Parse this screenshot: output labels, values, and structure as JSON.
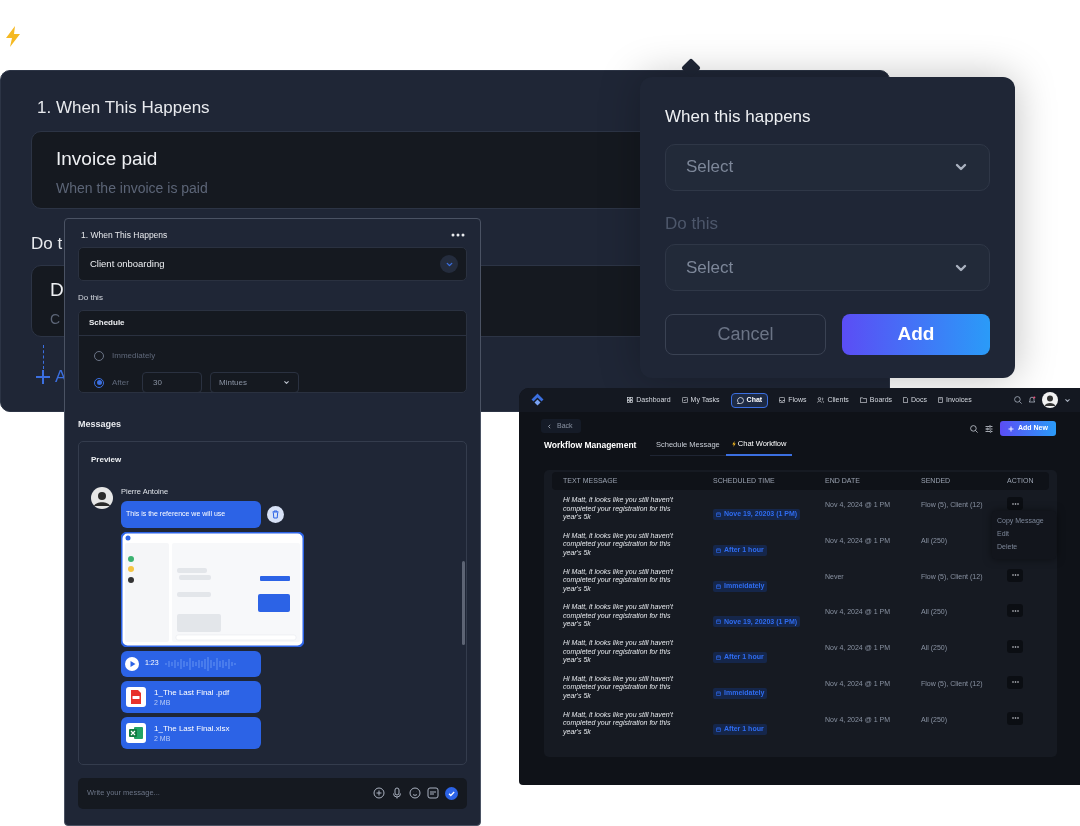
{
  "back_panel": {
    "title": "1. When This Happens",
    "trigger": {
      "title": "Invoice paid",
      "subtitle": "When the invoice is paid"
    },
    "action_label": "Do t",
    "action": {
      "title": "D",
      "subtitle": "C"
    },
    "add_link": "A"
  },
  "trigger_popover": {
    "heading": "When this happens",
    "trigger_select": {
      "placeholder": "Select"
    },
    "action_label": "Do this",
    "action_select": {
      "placeholder": "Select"
    },
    "cancel_button": "Cancel",
    "add_button": "Add"
  },
  "workflow_panel": {
    "title": "1. When This Happens",
    "trigger_select": {
      "value": "Client onboarding"
    },
    "action_label": "Do this",
    "schedule": {
      "title": "Schedule",
      "options": [
        {
          "label": "Immediately",
          "selected": false
        },
        {
          "label": "After",
          "selected": true
        }
      ],
      "amount": "30",
      "unit": "Mintues"
    },
    "messages_label": "Messages",
    "preview": {
      "title": "Preview",
      "sender": "Pierre Antoine",
      "messages": [
        {
          "kind": "text",
          "text": "This is the reference we will use"
        },
        {
          "kind": "image"
        },
        {
          "kind": "audio",
          "duration": "1:23"
        },
        {
          "kind": "pdf_file",
          "name": "1_The Last Final .pdf",
          "size": "2 MB"
        },
        {
          "kind": "spreadsheet_file",
          "name": "1_The Last Final.xlsx",
          "size": "2 MB"
        }
      ]
    },
    "composer": {
      "placeholder": "Write your message..."
    }
  },
  "dashboard": {
    "nav": [
      {
        "label": "Dashboard",
        "selected": false
      },
      {
        "label": "My Tasks",
        "selected": false
      },
      {
        "label": "Chat",
        "selected": true
      },
      {
        "label": "Flows",
        "selected": false
      },
      {
        "label": "Clients",
        "selected": false
      },
      {
        "label": "Boards",
        "selected": false
      },
      {
        "label": "Docs",
        "selected": false
      },
      {
        "label": "Invoices",
        "selected": false
      }
    ],
    "back_button": "Back",
    "title": "Workflow Management",
    "tabs": [
      {
        "label": "Schedule Message",
        "selected": false
      },
      {
        "label": "Chat Workflow",
        "selected": true
      }
    ],
    "add_button": "Add New",
    "table": {
      "columns": [
        "TEXT MESSAGE",
        "SCHEDULED TIME",
        "END DATE",
        "SENDED",
        "ACTION"
      ],
      "rows": [
        {
          "message": "Hi Matt, it looks like you still haven't completed your registration for this year's 5k",
          "scheduled": "Nove 19, 20203 (1 PM)",
          "end_date": "Nov 4, 2024 @ 1 PM",
          "sended": "Flow (5), Client (12)",
          "menu_open": true
        },
        {
          "message": "Hi Matt, it looks like you still haven't completed your registration for this year's 5k",
          "scheduled": "After 1 hour",
          "end_date": "Nov 4, 2024 @ 1 PM",
          "sended": "All (250)",
          "menu_open": false
        },
        {
          "message": "Hi Matt, it looks like you still haven't completed your registration for this year's 5k",
          "scheduled": "Immeidately",
          "end_date": "Never",
          "sended": "Flow (5), Client (12)",
          "menu_open": false
        },
        {
          "message": "Hi Matt, it looks like you still haven't completed your registration for this year's 5k",
          "scheduled": "Nove 19, 20203 (1 PM)",
          "end_date": "Nov 4, 2024 @ 1 PM",
          "sended": "All (250)",
          "menu_open": false
        },
        {
          "message": "Hi Matt, it looks like you still haven't completed your registration for this year's 5k",
          "scheduled": "After 1 hour",
          "end_date": "Nov 4, 2024 @ 1 PM",
          "sended": "All (250)",
          "menu_open": false
        },
        {
          "message": "Hi Matt, it looks like you still haven't completed your registration for this year's 5k",
          "scheduled": "Immeidately",
          "end_date": "Nov 4, 2024 @ 1 PM",
          "sended": "Flow (5), Client (12)",
          "menu_open": false
        },
        {
          "message": "Hi Matt, it looks like you still haven't completed your registration for this year's 5k",
          "scheduled": "After 1 hour",
          "end_date": "Nov 4, 2024 @ 1 PM",
          "sended": "All (250)",
          "menu_open": false
        }
      ]
    },
    "row_menu": [
      "Copy Message",
      "Edit",
      "Delete"
    ]
  }
}
